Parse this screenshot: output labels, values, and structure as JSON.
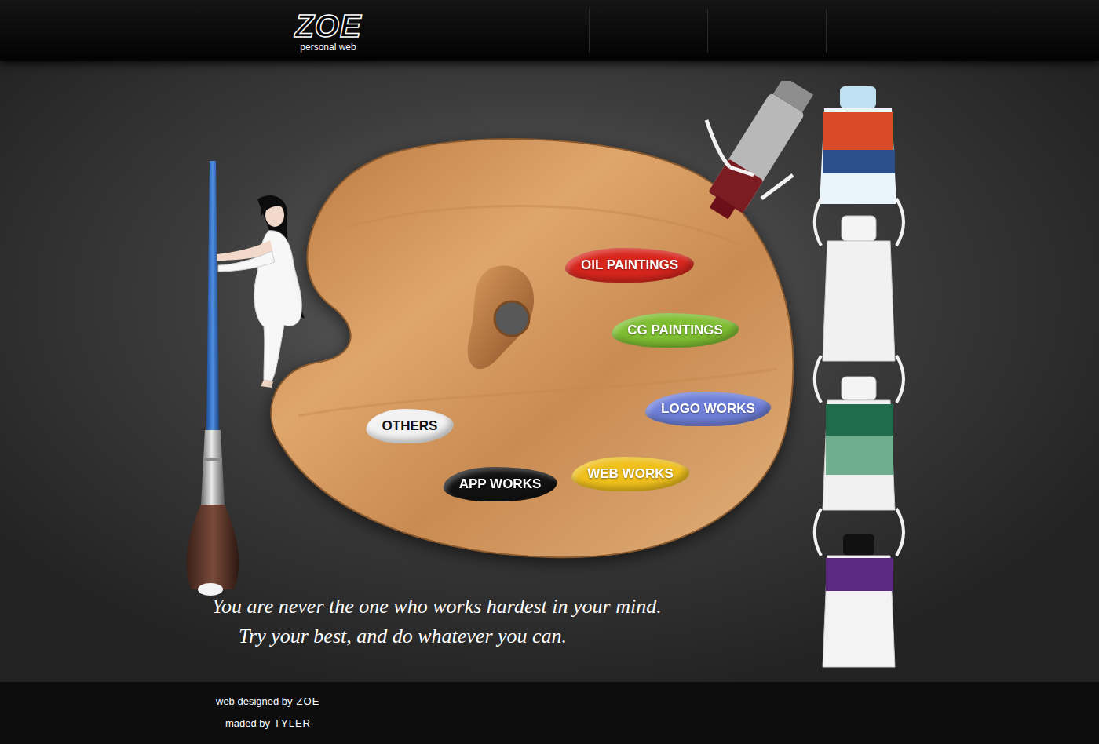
{
  "header": {
    "logo": "ZOE",
    "subtitle": "personal web",
    "nav_dividers": 3
  },
  "palette": {
    "blobs": [
      {
        "label": "OIL PAINTINGS",
        "color": "#d8261d"
      },
      {
        "label": "CG PAINTINGS",
        "color": "#7fbe32"
      },
      {
        "label": "LOGO WORKS",
        "color": "#6f7fd8"
      },
      {
        "label": "OTHERS",
        "color": "#f2f2f2"
      },
      {
        "label": "APP WORKS",
        "color": "#121212"
      },
      {
        "label": "WEB WORKS",
        "color": "#f0c01c"
      }
    ]
  },
  "quote": {
    "lines": [
      "You are never the one who works hardest in your mind.",
      "Try your best, and do whatever you can."
    ]
  },
  "footer": {
    "lines": [
      {
        "prefix": "web designed by",
        "name": "ZOE"
      },
      {
        "prefix": "maded by",
        "name": "TYLER"
      }
    ]
  }
}
